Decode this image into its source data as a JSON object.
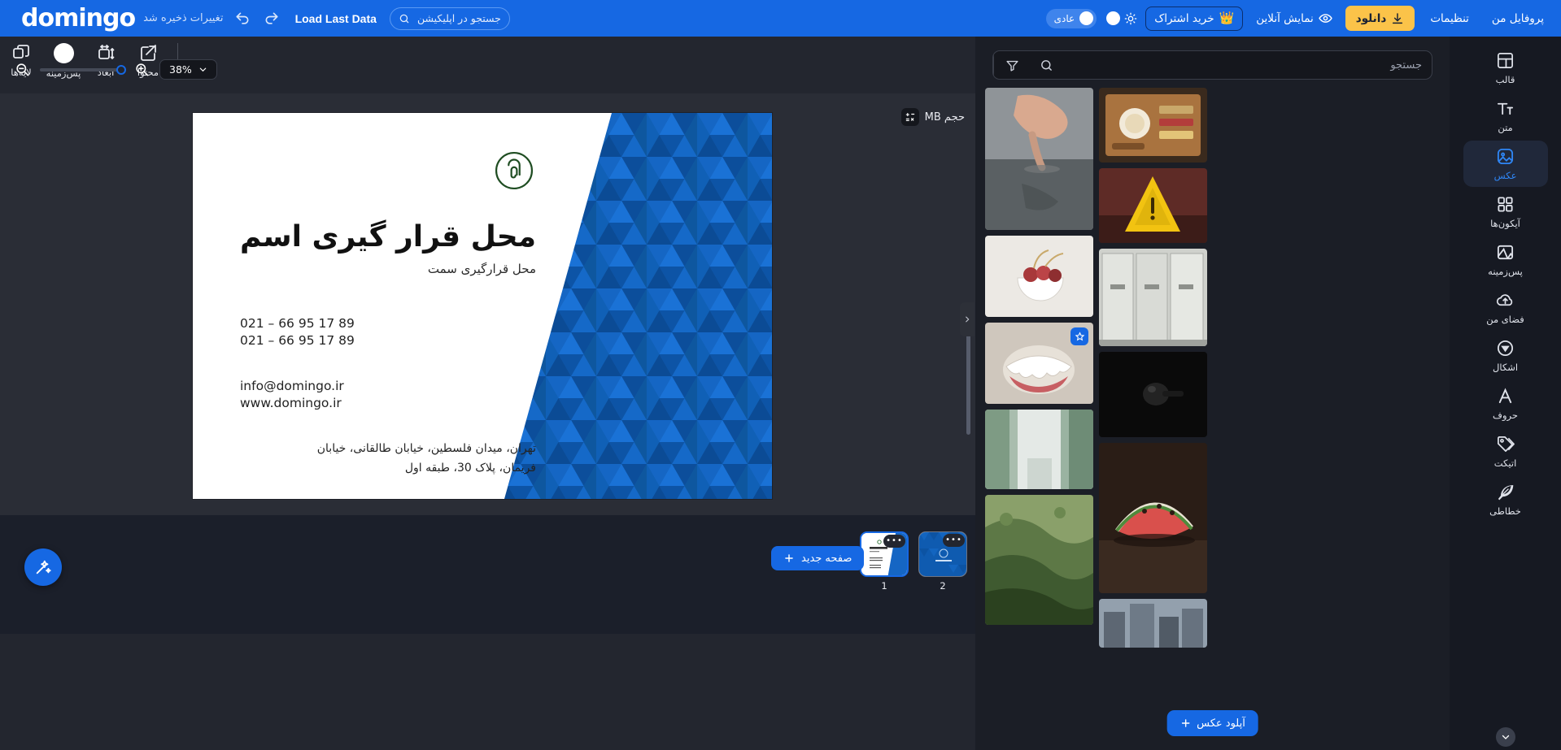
{
  "topbar": {
    "logo": "domingo",
    "saved_message": "تغییرات ذخیره شد",
    "undo_icon": "undo-icon",
    "redo_icon": "redo-icon",
    "load_last_data": "Load Last Data",
    "search_placeholder": "جستجو در اپلیکیشن...",
    "search_value": "",
    "mode_label": "عادی",
    "subscribe_label": "خرید اشتراک",
    "crown": "👑",
    "preview_label": "نمایش آنلاین",
    "download_label": "دانلود",
    "settings_label": "تنظیمات",
    "profile_label": "پروفایل من"
  },
  "toolbar": {
    "items": [
      {
        "label": "محتوا",
        "icon": "edit-content-icon"
      },
      {
        "label": "ابعاد",
        "icon": "dimensions-icon"
      },
      {
        "label": "پس‌زمینه",
        "icon": "background-circle-icon"
      },
      {
        "label": "لایه‌ها",
        "icon": "layers-icon"
      }
    ]
  },
  "canvas": {
    "size_badge": {
      "label": "حجم MB",
      "icon": "calculator-icon"
    },
    "card": {
      "logo_icon": "green-circle-monogram-icon",
      "title": "محل قرار گیری اسم",
      "subtitle": "محل قرارگیری سمت",
      "phone1": "021 – 66 95 17 89",
      "phone2": "021 – 66 95 17 89",
      "email": "info@domingo.ir",
      "website": "www.domingo.ir",
      "address_line1": "تهران، میدان فلسطین، خیابان طالقانی، خیابان",
      "address_line2": "فریمان، پلاک 30، طبقه اول",
      "accent_color": "#1459a8",
      "logo_color": "#1f4d22"
    }
  },
  "bottombar": {
    "zoom_value": "38%",
    "zoom_in_icon": "zoom-in-icon",
    "zoom_out_icon": "zoom-out-icon",
    "new_page_label": "صفحه جدید",
    "pages": [
      {
        "number": "1",
        "active": true,
        "menu": "•••"
      },
      {
        "number": "2",
        "active": false,
        "menu": "•••"
      }
    ]
  },
  "image_panel": {
    "search_placeholder": "جستجو",
    "search_value": "",
    "filter_icon": "filter-icon",
    "search_icon": "search-icon",
    "upload_label": "آپلود عکس",
    "images": [
      {
        "name": "hand-in-water",
        "c1": "#9a9fa2",
        "c2": "#4e5355"
      },
      {
        "name": "cherries-in-bowl",
        "c1": "#e9e6e2",
        "c2": "#b14b4a"
      },
      {
        "name": "dentures-model",
        "c1": "#d8d2cb",
        "c2": "#8d7f74",
        "favorite": true
      },
      {
        "name": "greenhouse-walkway",
        "c1": "#b9c8bd",
        "c2": "#5e7a68"
      },
      {
        "name": "forest-hills",
        "c1": "#6c7d4e",
        "c2": "#2f4024"
      },
      {
        "name": "breakfast-board",
        "c1": "#a6743f",
        "c2": "#4a3120"
      },
      {
        "name": "wet-floor-sign",
        "c1": "#c9a227",
        "c2": "#6b2f2a"
      },
      {
        "name": "metal-lockers",
        "c1": "#d5d6d1",
        "c2": "#8d8f8b"
      },
      {
        "name": "black-object-dark",
        "c1": "#1c1c1c",
        "c2": "#080808"
      },
      {
        "name": "watermelon-slice",
        "c1": "#d65f5a",
        "c2": "#2e2018"
      },
      {
        "name": "city-buildings",
        "c1": "#8e99a5",
        "c2": "#4c5661"
      }
    ]
  },
  "right_sidebar": {
    "items": [
      {
        "label": "قالب",
        "icon": "template-icon",
        "active": false
      },
      {
        "label": "متن",
        "icon": "text-icon",
        "active": false
      },
      {
        "label": "عکس",
        "icon": "image-icon",
        "active": true
      },
      {
        "label": "آیکون‌ها",
        "icon": "grid-icons-icon",
        "active": false
      },
      {
        "label": "پس‌زمینه",
        "icon": "background-icon",
        "active": false
      },
      {
        "label": "فضای من",
        "icon": "cloud-upload-icon",
        "active": false
      },
      {
        "label": "اشکال",
        "icon": "shapes-icon",
        "active": false
      },
      {
        "label": "حروف",
        "icon": "letters-icon",
        "active": false
      },
      {
        "label": "اتیکت",
        "icon": "tag-icon",
        "active": false
      },
      {
        "label": "خطاطی",
        "icon": "feather-icon",
        "active": false
      }
    ]
  }
}
